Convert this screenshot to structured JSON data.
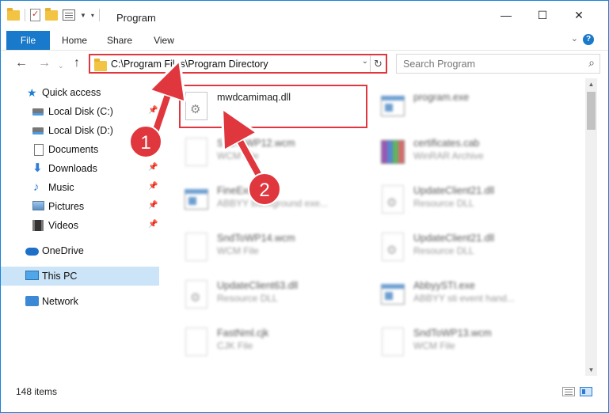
{
  "window": {
    "title": "Program",
    "accent": "#1979ca",
    "highlight": "#e0363d"
  },
  "ribbon": {
    "file": "File",
    "home": "Home",
    "share": "Share",
    "view": "View"
  },
  "nav": {
    "address": "C:\\Program Files\\Program Directory",
    "search_placeholder": "Search Program"
  },
  "sidebar": {
    "items": [
      {
        "label": "Quick access",
        "icon": "star-icon"
      },
      {
        "label": "Local Disk (C:)",
        "icon": "drive-icon"
      },
      {
        "label": "Local Disk (D:)",
        "icon": "drive-icon"
      },
      {
        "label": "Documents",
        "icon": "documents-icon"
      },
      {
        "label": "Downloads",
        "icon": "downloads-icon"
      },
      {
        "label": "Music",
        "icon": "music-icon"
      },
      {
        "label": "Pictures",
        "icon": "pictures-icon"
      },
      {
        "label": "Videos",
        "icon": "videos-icon"
      },
      {
        "label": "OneDrive",
        "icon": "cloud-icon"
      },
      {
        "label": "This PC",
        "icon": "computer-icon"
      },
      {
        "label": "Network",
        "icon": "network-icon"
      }
    ]
  },
  "files": {
    "left": [
      {
        "name": "mwdcamimaq.dll",
        "type": ""
      },
      {
        "name": "SndToWP12.wcm",
        "type": "WCM File"
      },
      {
        "name": "FineExec.exe",
        "type": "ABBYY Background exe..."
      },
      {
        "name": "SndToWP14.wcm",
        "type": "WCM File"
      },
      {
        "name": "UpdateClient63.dll",
        "type": "Resource DLL"
      },
      {
        "name": "FastNml.cjk",
        "type": "CJK File"
      }
    ],
    "right": [
      {
        "name": "program.exe",
        "type": ""
      },
      {
        "name": "certificates.cab",
        "type": "WinRAR Archive"
      },
      {
        "name": "UpdateClient21.dll",
        "type": "Resource DLL"
      },
      {
        "name": "UpdateClient21.dll",
        "type": "Resource DLL"
      },
      {
        "name": "AbbyySTI.exe",
        "type": "ABBYY sti event hand..."
      },
      {
        "name": "SndToWP13.wcm",
        "type": "WCM File"
      }
    ]
  },
  "status": {
    "items": "148 items"
  },
  "annotations": {
    "step1": "1",
    "step2": "2"
  }
}
